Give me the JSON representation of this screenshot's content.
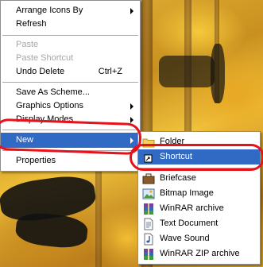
{
  "context_menu": {
    "items": [
      {
        "label": "Arrange Icons By",
        "submenu": true
      },
      {
        "label": "Refresh"
      },
      {
        "label": "Paste",
        "disabled": true
      },
      {
        "label": "Paste Shortcut",
        "disabled": true
      },
      {
        "label": "Undo Delete",
        "accel": "Ctrl+Z"
      },
      {
        "label": "Save As Scheme..."
      },
      {
        "label": "Graphics Options",
        "submenu": true
      },
      {
        "label": "Display Modes",
        "submenu": true
      },
      {
        "label": "New",
        "submenu": true,
        "highlighted": true
      },
      {
        "label": "Properties"
      }
    ]
  },
  "new_submenu": {
    "items": [
      {
        "label": "Folder",
        "icon": "folder-icon"
      },
      {
        "label": "Shortcut",
        "icon": "shortcut-icon",
        "highlighted": true
      },
      {
        "label": "Briefcase",
        "icon": "briefcase-icon"
      },
      {
        "label": "Bitmap Image",
        "icon": "bitmap-image-icon"
      },
      {
        "label": "WinRAR archive",
        "icon": "winrar-archive-icon"
      },
      {
        "label": "Text Document",
        "icon": "text-document-icon"
      },
      {
        "label": "Wave Sound",
        "icon": "wave-sound-icon"
      },
      {
        "label": "WinRAR ZIP archive",
        "icon": "winrar-zip-icon"
      }
    ]
  },
  "colors": {
    "highlight": "#316ac5",
    "annotation": "#e8101a"
  }
}
